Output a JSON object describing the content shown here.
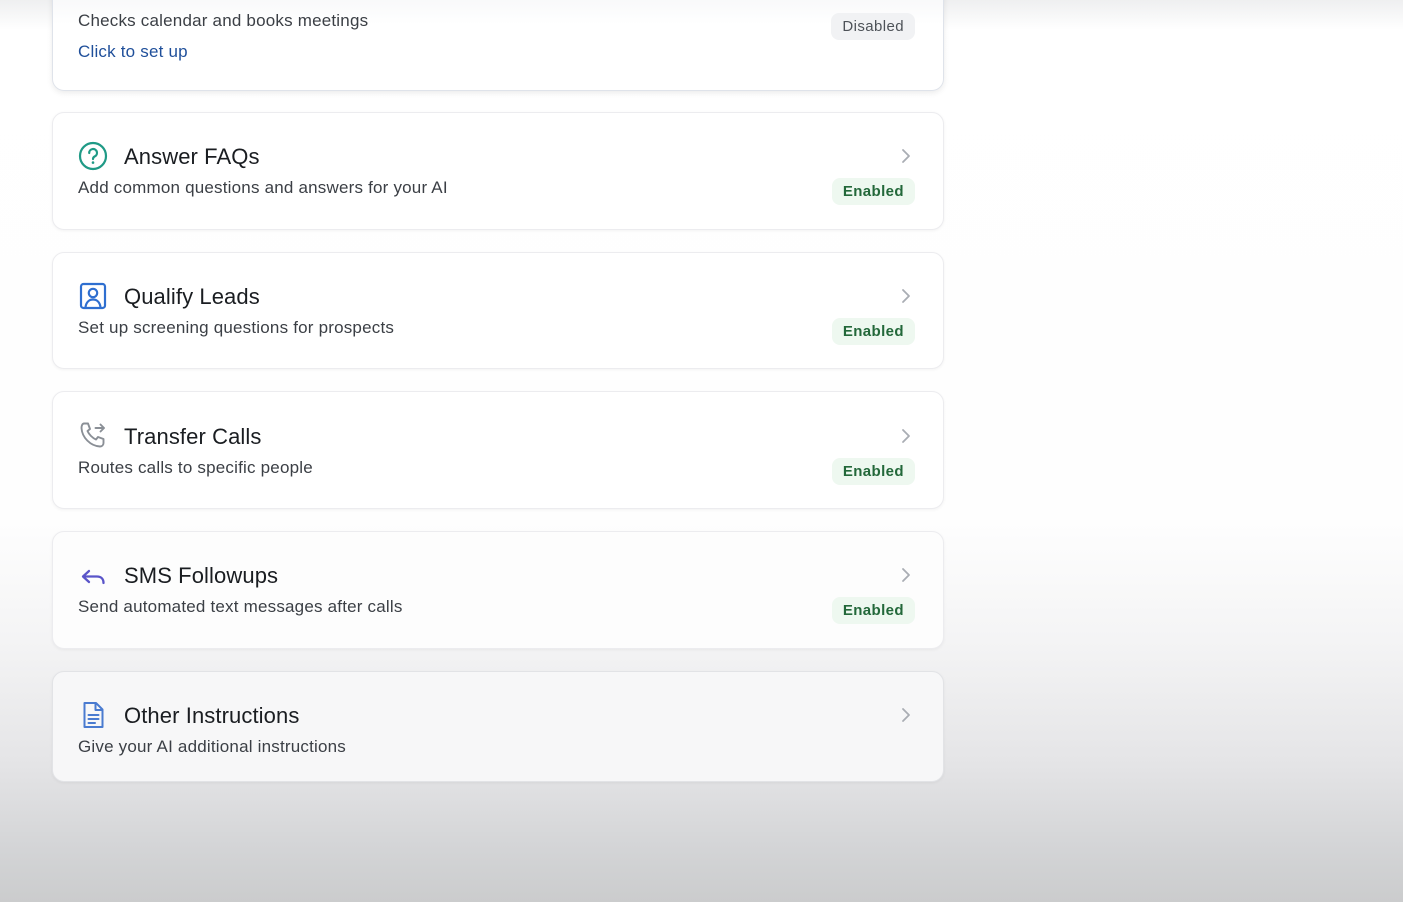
{
  "colors": {
    "enabled_bg": "#eef8f0",
    "enabled_text": "#23683a",
    "disabled_bg": "#f1f2f4",
    "link": "#1f4f9a",
    "faq_icon": "#1f9a86",
    "leads_icon": "#2f6fd0",
    "sms_icon": "#5a55c9",
    "other_icon": "#4a7bd0"
  },
  "cards": [
    {
      "id": "book-appointments",
      "icon": "calendar-icon",
      "description": "Checks calendar and books meetings",
      "link": "Click to set up",
      "status": "Disabled"
    },
    {
      "id": "answer-faqs",
      "icon": "question-circle-icon",
      "title": "Answer FAQs",
      "description": "Add common questions and answers for your AI",
      "status": "Enabled"
    },
    {
      "id": "qualify-leads",
      "icon": "user-badge-icon",
      "title": "Qualify Leads",
      "description": "Set up screening questions for prospects",
      "status": "Enabled"
    },
    {
      "id": "transfer-calls",
      "icon": "phone-forward-icon",
      "title": "Transfer Calls",
      "description": "Routes calls to specific people",
      "status": "Enabled"
    },
    {
      "id": "sms-followups",
      "icon": "reply-arrow-icon",
      "title": "SMS Followups",
      "description": "Send automated text messages after calls",
      "status": "Enabled"
    },
    {
      "id": "other-instructions",
      "icon": "document-icon",
      "title": "Other Instructions",
      "description": "Give your AI additional instructions"
    }
  ]
}
